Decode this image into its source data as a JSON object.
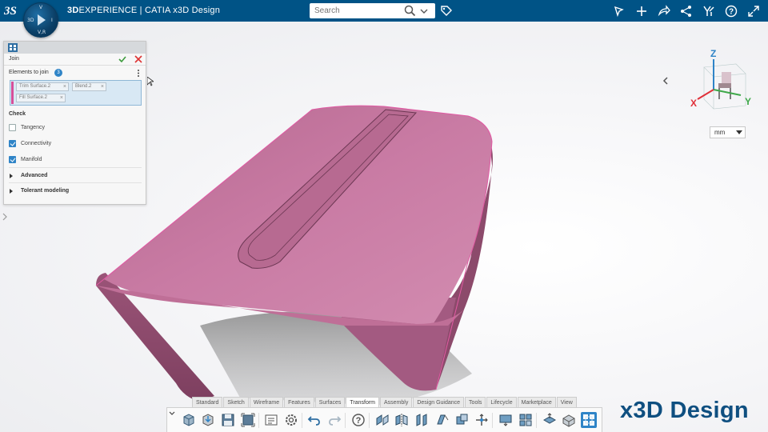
{
  "topbar": {
    "brand_prefix": "3D",
    "brand_mid": "EXPERIENCE",
    "brand_sep": " | ",
    "brand_app_caps": "CATIA",
    "brand_app": " x3D Design",
    "compass": {
      "top": "V",
      "left": "3D",
      "right": "I",
      "bottom": "V,R"
    },
    "search": {
      "placeholder": "Search"
    },
    "icons": [
      "share-arrow-icon",
      "add-icon",
      "forward-icon",
      "share-icon",
      "community-icon",
      "help-icon",
      "collapse-icon"
    ]
  },
  "panel": {
    "title": "Join",
    "elements_label": "Elements to join",
    "elements_count": "3",
    "chips": [
      "Trim Surface.2",
      "Blend.2",
      "Fill Surface.2"
    ],
    "check_header": "Check",
    "options": [
      {
        "label": "Tangency",
        "checked": false
      },
      {
        "label": "Connectivity",
        "checked": true
      },
      {
        "label": "Manifold",
        "checked": true
      }
    ],
    "sections": [
      "Advanced",
      "Tolerant modeling"
    ]
  },
  "viewport": {
    "units": "mm",
    "axes": {
      "z": "Z",
      "y": "Y",
      "x": "X"
    },
    "surface_color": "#c97ba4"
  },
  "toolbar": {
    "tabs": [
      "Standard",
      "Sketch",
      "Wireframe",
      "Features",
      "Surfaces",
      "Transform",
      "Assembly",
      "Design Guidance",
      "Tools",
      "Lifecycle",
      "Marketplace",
      "View"
    ],
    "active_tab": "Transform",
    "tools": [
      "open-3d-icon",
      "import-icon",
      "save-icon",
      "save-as-icon",
      "properties-icon",
      "settings-icon",
      "undo-icon",
      "redo-icon",
      "help-icon",
      "translate-icon",
      "mirror-icon",
      "symmetry-icon",
      "scale-icon",
      "rotate-icon",
      "affinity-icon",
      "axis-to-axis-icon",
      "extrapolate-icon",
      "pattern-icon",
      "move-icon",
      "position-icon",
      "join-icon"
    ]
  },
  "watermark": "x3D Design",
  "colors": {
    "topbar": "#005386",
    "accent": "#2f84c7",
    "pink_bar": "#d64f9a",
    "watermark": "#0f4f80"
  }
}
